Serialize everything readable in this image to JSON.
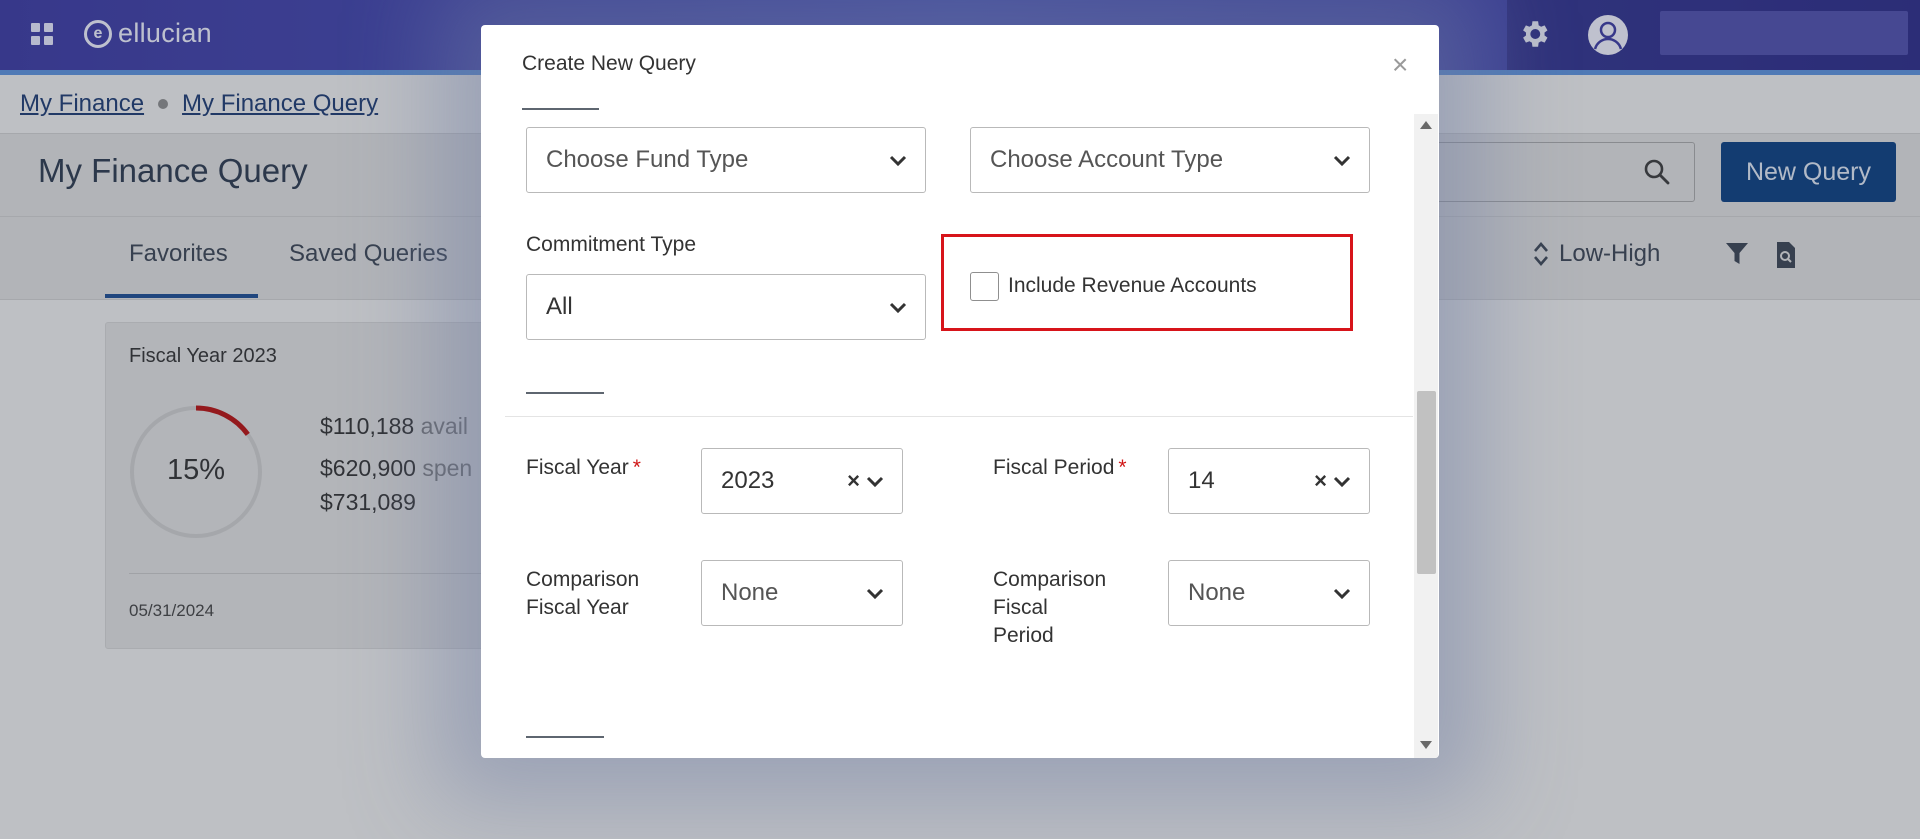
{
  "app": {
    "brand": "ellucian"
  },
  "breadcrumb": {
    "items": [
      "My Finance",
      "My Finance Query"
    ]
  },
  "page": {
    "title": "My Finance Query",
    "new_query_label": "New Query"
  },
  "tabs": [
    {
      "label": "Favorites",
      "active": true
    },
    {
      "label": "Saved Queries",
      "active": false
    }
  ],
  "sort": {
    "label": "Low-High"
  },
  "fy_card": {
    "title": "Fiscal Year 2023",
    "percent_label": "15%",
    "percent_value": 15,
    "available_value": "$110,188",
    "available_partial": "avail",
    "spent_value": "$620,900",
    "spent_partial": "spen",
    "total_value": "$731,089",
    "date": "05/31/2024"
  },
  "modal": {
    "title": "Create New Query",
    "close_glyph": "×",
    "fund_type": {
      "placeholder": "Choose Fund Type"
    },
    "account_type": {
      "placeholder": "Choose Account Type"
    },
    "commitment_type": {
      "label": "Commitment Type",
      "value": "All"
    },
    "include_revenue": {
      "label": "Include Revenue Accounts",
      "checked": false
    },
    "fiscal_year": {
      "label": "Fiscal Year",
      "required_mark": "*",
      "value": "2023",
      "clear_glyph": "×"
    },
    "fiscal_period": {
      "label": "Fiscal Period",
      "required_mark": "*",
      "value": "14",
      "clear_glyph": "×"
    },
    "comparison_fiscal_year": {
      "label_line1": "Comparison",
      "label_line2": "Fiscal Year",
      "value": "None"
    },
    "comparison_fiscal_period": {
      "label_line1": "Comparison",
      "label_line2": "Fiscal",
      "label_line3": "Period",
      "value": "None"
    }
  },
  "colors": {
    "accent": "#0d3f7e",
    "highlight": "#d7141a",
    "required": "#d01717",
    "header": "#3c3a9e"
  }
}
